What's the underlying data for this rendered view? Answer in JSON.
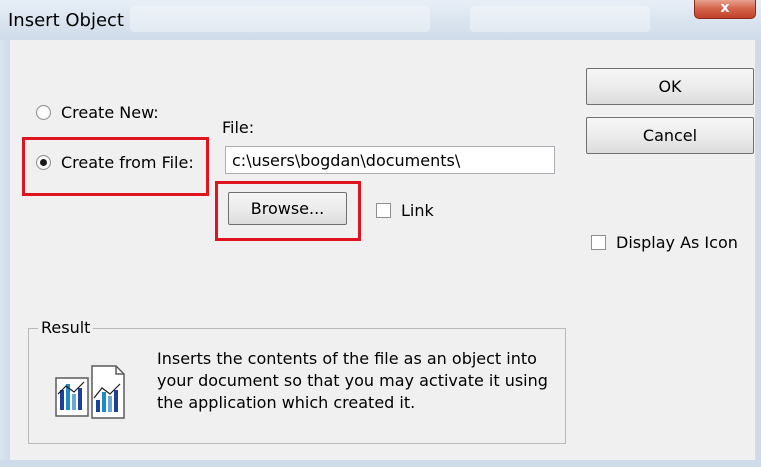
{
  "window": {
    "title": "Insert Object",
    "close_icon": "close-x-icon",
    "close_glyph": "x"
  },
  "options": {
    "create_new_label": "Create New:",
    "create_from_file_label": "Create from File:",
    "selected": "create_from_file"
  },
  "file": {
    "label": "File:",
    "value": "c:\\users\\bogdan\\documents\\",
    "browse_label": "Browse...",
    "link_label": "Link"
  },
  "buttons": {
    "ok_label": "OK",
    "cancel_label": "Cancel"
  },
  "display_as_icon_label": "Display As Icon",
  "result": {
    "title": "Result",
    "line1": "Inserts the contents of the file as an object into",
    "line2": "your document so that you may activate it using",
    "line3": "the application which created it.",
    "icon": "document-chart-icon"
  },
  "colors": {
    "highlight": "#e0141e",
    "dialog_bg": "#f0f0f0"
  }
}
